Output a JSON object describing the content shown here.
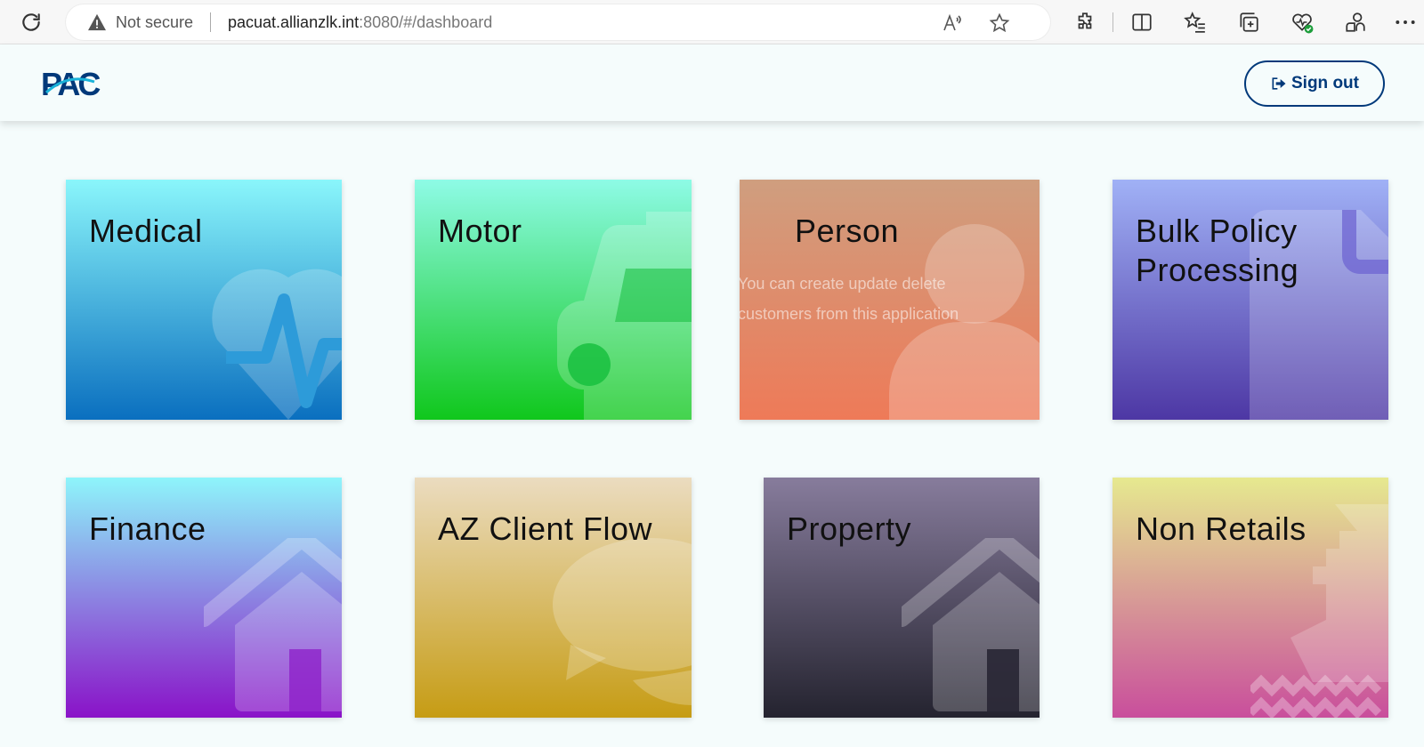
{
  "browser": {
    "security_label": "Not secure",
    "url_host": "pacuat.allianzlk.int",
    "url_rest": ":8080/#/dashboard",
    "icons": [
      "reload-icon",
      "warning-icon",
      "read-aloud-icon",
      "favorite-star-icon",
      "extensions-icon",
      "split-screen-icon",
      "favorites-icon",
      "collections-icon",
      "browser-essentials-icon",
      "profile-icon",
      "more-icon"
    ]
  },
  "header": {
    "logo_text": "PAC",
    "signout_label": "Sign out",
    "accent_color": "#00397a"
  },
  "tiles": [
    {
      "title": "Medical",
      "icon": "heart-pulse-icon"
    },
    {
      "title": "Motor",
      "icon": "car-icon"
    },
    {
      "title": "Person",
      "icon": "user-icon",
      "description_line1": "You can create update delete",
      "description_line2": "customers from this application"
    },
    {
      "title_line1": "Bulk Policy",
      "title_line2": "Processing",
      "icon": "document-icon"
    },
    {
      "title": "Finance",
      "icon": "home-icon"
    },
    {
      "title": "AZ Client Flow",
      "icon": "chat-bubbles-icon"
    },
    {
      "title": "Property",
      "icon": "home-icon"
    },
    {
      "title": "Non Retails",
      "icon": "ship-icon"
    }
  ]
}
